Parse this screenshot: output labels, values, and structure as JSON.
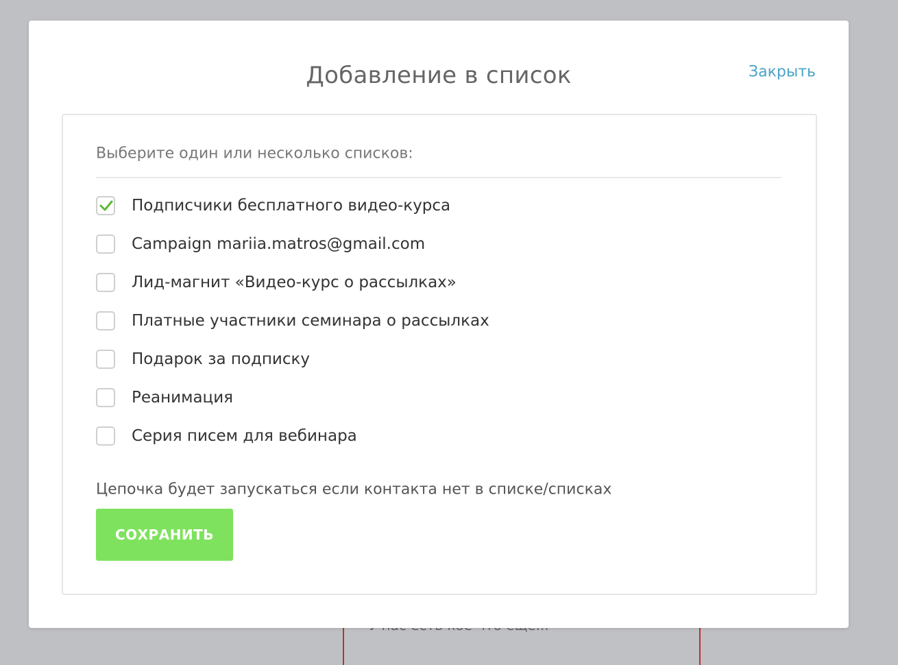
{
  "background": {
    "text": "У нас есть кое-что еще..."
  },
  "modal": {
    "title": "Добавление в список",
    "close_label": "Закрыть",
    "instruction": "Выберите один или несколько списков:",
    "lists": [
      {
        "label": "Подписчики бесплатного видео-курса",
        "checked": true
      },
      {
        "label": "Campaign mariia.matros@gmail.com",
        "checked": false
      },
      {
        "label": "Лид-магнит «Видео-курс о рассылках»",
        "checked": false
      },
      {
        "label": "Платные участники семинара о рассылках",
        "checked": false
      },
      {
        "label": "Подарок за подписку",
        "checked": false
      },
      {
        "label": "Реанимация",
        "checked": false
      },
      {
        "label": "Серия писем для вебинара",
        "checked": false
      }
    ],
    "note": "Цепочка будет запускаться если контакта нет в списке/списках",
    "save_label": "СОХРАНИТЬ"
  },
  "colors": {
    "accent_link": "#4aa3c7",
    "save_button": "#7fe25e",
    "check_mark": "#5cb83a",
    "overlay": "#bfc0c4"
  },
  "icons": {
    "check": "check-icon"
  }
}
